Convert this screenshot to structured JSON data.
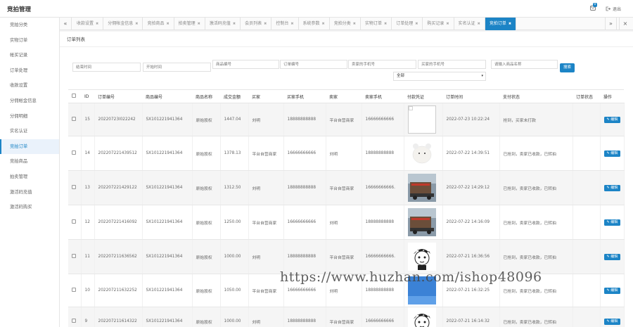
{
  "app_title": "竞拍管理",
  "header": {
    "badge": "0",
    "logout_label": "退出"
  },
  "sidebar": {
    "items": [
      {
        "label": "竞拍分类",
        "active": false
      },
      {
        "label": "实物订单",
        "active": false
      },
      {
        "label": "帐买记录",
        "active": false
      },
      {
        "label": "订单处理",
        "active": false
      },
      {
        "label": "收款设置",
        "active": false
      },
      {
        "label": "分佣帐金信息",
        "active": false
      },
      {
        "label": "分佣明细",
        "active": false
      },
      {
        "label": "实名认证",
        "active": false
      },
      {
        "label": "竞拍订单",
        "active": true
      },
      {
        "label": "竞拍商品",
        "active": false
      },
      {
        "label": "拍卖管理",
        "active": false
      },
      {
        "label": "激活码充值",
        "active": false
      },
      {
        "label": "激活码购买",
        "active": false
      }
    ]
  },
  "tabs": [
    {
      "label": "收款设置",
      "active": false
    },
    {
      "label": "分佣帐金信息",
      "active": false
    },
    {
      "label": "竞拍商品",
      "active": false
    },
    {
      "label": "拍卖管理",
      "active": false
    },
    {
      "label": "激活码充值",
      "active": false
    },
    {
      "label": "会员列表",
      "active": false
    },
    {
      "label": "控制台",
      "active": false
    },
    {
      "label": "系统参数",
      "active": false
    },
    {
      "label": "竞拍分类",
      "active": false
    },
    {
      "label": "实物订单",
      "active": false
    },
    {
      "label": "订单处理",
      "active": false
    },
    {
      "label": "购买记录",
      "active": false
    },
    {
      "label": "实名认证",
      "active": false
    },
    {
      "label": "竞拍订单",
      "active": true
    }
  ],
  "panel_title": "订单列表",
  "filters": {
    "end_time": "结束时间",
    "start_time": "开始时间",
    "goods_no": "商品编号",
    "order_no": "订单编号",
    "seller_phone": "卖家的手机号",
    "buyer_phone": "买家的手机号",
    "keyword": "请输入商品名称",
    "search_label": "搜索",
    "status_select": "全部"
  },
  "table": {
    "columns": [
      "ID",
      "订单编号",
      "商品编号",
      "商品名称",
      "成交金额",
      "买家",
      "买家手机",
      "卖家",
      "卖家手机",
      "付款凭证",
      "订单时间",
      "支付状态",
      "订单状态",
      "操作"
    ],
    "edit_label": "编辑",
    "rows": [
      {
        "id": "15",
        "order_no": "20220723l022242",
        "goods_no": "SX101221941364",
        "goods_name": "原始股权",
        "amount": "1447.04",
        "buyer": "刘明",
        "buyer_phone": "18888888888",
        "seller": "平台自营商家",
        "seller_phone": "16666666666",
        "proof": "blank-proof",
        "time": "2022-07-23 10:22:24",
        "pay_status": "抢到，买家未打款",
        "order_status": ""
      },
      {
        "id": "14",
        "order_no": "202207221439512",
        "goods_no": "SX101221941364",
        "goods_name": "原始股权",
        "amount": "1378.13",
        "buyer": "平台自营商家",
        "buyer_phone": "16666666666",
        "seller": "刘明",
        "seller_phone": "18888888888",
        "proof": "plush-toy-photo",
        "time": "2022-07-22 14:39:51",
        "pay_status": "已抢到，卖家已收款，已转拍",
        "order_status": ""
      },
      {
        "id": "13",
        "order_no": "202207221429122",
        "goods_no": "SX101221941364",
        "goods_name": "原始股权",
        "amount": "1312.50",
        "buyer": "刘明",
        "buyer_phone": "18888888888",
        "seller": "平台自营商家",
        "seller_phone": "16666666666.",
        "proof": "truck-photo",
        "time": "2022-07-22 14:29:12",
        "pay_status": "已抢到，卖家已收款，已转拍",
        "order_status": ""
      },
      {
        "id": "12",
        "order_no": "202207221416092",
        "goods_no": "SX101221941364",
        "goods_name": "原始股权",
        "amount": "1250.00",
        "buyer": "平台自营商家",
        "buyer_phone": "16666666666",
        "seller": "刘明",
        "seller_phone": "18888888888",
        "proof": "truck-photo",
        "time": "2022-07-22 14:16:09",
        "pay_status": "已抢到，卖家已收款，已转拍",
        "order_status": ""
      },
      {
        "id": "11",
        "order_no": "202207211636562",
        "goods_no": "SX101221941364",
        "goods_name": "原始股权",
        "amount": "1000.00",
        "buyer": "刘明",
        "buyer_phone": "18888888888",
        "seller": "平台自营商家",
        "seller_phone": "16666666666.",
        "proof": "cartoon-face",
        "time": "2022-07-21 16:36:56",
        "pay_status": "已抢到，卖家已收款，已转拍",
        "order_status": ""
      },
      {
        "id": "10",
        "order_no": "202207211632252",
        "goods_no": "SX101221941364",
        "goods_name": "原始股权",
        "amount": "1050.00",
        "buyer": "平台自营商家",
        "buyer_phone": "16666666666",
        "seller": "刘明",
        "seller_phone": "18888888888",
        "proof": "blue-image",
        "time": "2022-07-21 16:32:25",
        "pay_status": "已抢到，卖家已收款，已转拍",
        "order_status": ""
      },
      {
        "id": "9",
        "order_no": "202207211614322",
        "goods_no": "SX101221941364",
        "goods_name": "原始股权",
        "amount": "1000.00",
        "buyer": "刘明",
        "buyer_phone": "18888888888",
        "seller": "平台自营商家",
        "seller_phone": "16666666666",
        "proof": "cartoon-face",
        "time": "2022-07-21 16:14:32",
        "pay_status": "已抢到，卖家已收款，已转拍",
        "order_status": ""
      }
    ]
  },
  "watermark": "https://www.huzhan.com/ishop48096",
  "colors": {
    "accent": "#1c84c6"
  }
}
